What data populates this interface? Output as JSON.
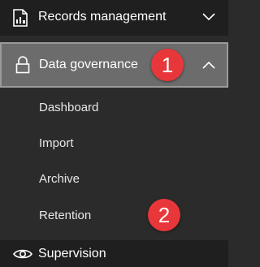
{
  "nav": {
    "records_management": {
      "label": "Records management",
      "icon": "records-icon",
      "expanded": false
    },
    "data_governance": {
      "label": "Data governance",
      "icon": "lock-icon",
      "expanded": true,
      "items": [
        {
          "label": "Dashboard"
        },
        {
          "label": "Import"
        },
        {
          "label": "Archive"
        },
        {
          "label": "Retention"
        }
      ]
    },
    "supervision": {
      "label": "Supervision",
      "icon": "eye-icon"
    }
  },
  "callouts": {
    "badge_1": "1",
    "badge_2": "2"
  },
  "colors": {
    "selected_bg": "#6c6c6c",
    "badge": "#e8373a",
    "panel_bg": "#2b2b2b"
  }
}
